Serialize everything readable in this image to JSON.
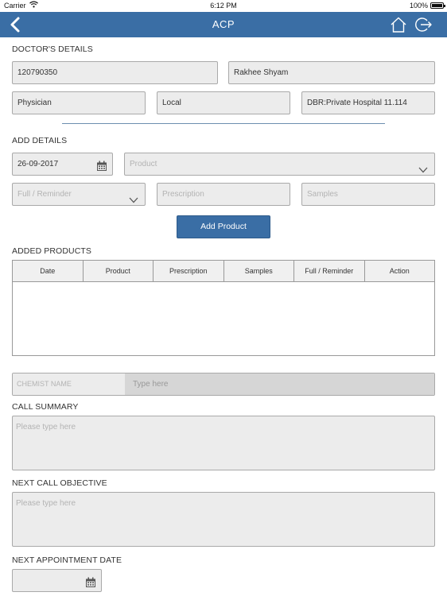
{
  "status_bar": {
    "carrier": "Carrier",
    "time": "6:12 PM",
    "battery": "100%"
  },
  "nav": {
    "title": "ACP",
    "icons": {
      "back": "chevron-left-icon",
      "home": "home-icon",
      "logout": "logout-icon"
    }
  },
  "doctor": {
    "section_label": "DOCTOR'S DETAILS",
    "id": "120790350",
    "name": "Rakhee Shyam",
    "specialty": "Physician",
    "location": "Local",
    "hospital": "DBR:Private Hospital 11.114"
  },
  "add_details": {
    "section_label": "ADD DETAILS",
    "date": "26-09-2017",
    "product_placeholder": "Product",
    "full_reminder_placeholder": "Full / Reminder",
    "prescription_placeholder": "Prescription",
    "samples_placeholder": "Samples",
    "add_button": "Add Product"
  },
  "added_products": {
    "section_label": "ADDED PRODUCTS",
    "columns": [
      "Date",
      "Product",
      "Prescription",
      "Samples",
      "Full / Reminder",
      "Action"
    ],
    "rows": []
  },
  "chemist": {
    "label": "CHEMIST NAME",
    "placeholder": "Type here"
  },
  "call_summary": {
    "label": "CALL SUMMARY",
    "placeholder": "Please type here"
  },
  "next_call": {
    "label": "NEXT CALL OBJECTIVE",
    "placeholder": "Please type here"
  },
  "next_appointment": {
    "label": "NEXT APPOINTMENT DATE",
    "value": ""
  },
  "colors": {
    "accent": "#3a6ea5",
    "field_bg": "#ececec",
    "border": "#a9a9a9"
  }
}
